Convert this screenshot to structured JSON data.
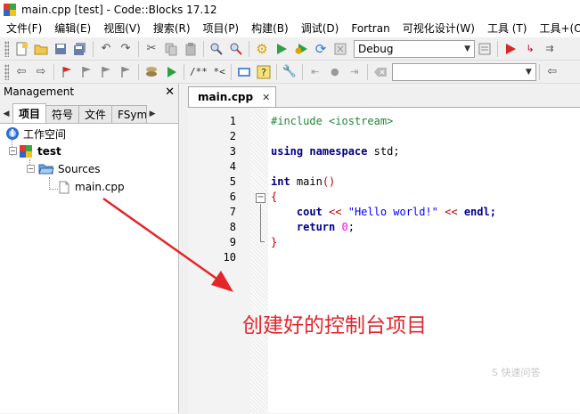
{
  "window": {
    "title": "main.cpp [test] - Code::Blocks 17.12"
  },
  "menu": [
    "文件(F)",
    "编辑(E)",
    "视图(V)",
    "搜索(R)",
    "项目(P)",
    "构建(B)",
    "调试(D)",
    "Fortran",
    "可视化设计(W)",
    "工具 (T)",
    "工具+(O)"
  ],
  "toolbar": {
    "build_target": "Debug",
    "doc_comment": "/** *<",
    "search_value": ""
  },
  "management": {
    "title": "Management",
    "tabs": [
      "项目",
      "符号",
      "文件",
      "FSym"
    ],
    "tree": {
      "workspace": "工作空间",
      "project": "test",
      "folder": "Sources",
      "file": "main.cpp"
    }
  },
  "editor": {
    "tab_label": "main.cpp",
    "line_numbers": [
      "1",
      "2",
      "3",
      "4",
      "5",
      "6",
      "7",
      "8",
      "9",
      "10"
    ],
    "code": {
      "l1_include": "#include <iostream>",
      "l3_using": "using",
      "l3_namespace": "namespace",
      "l3_std": "std;",
      "l5_int": "int",
      "l5_main": "main",
      "l5_parens": "()",
      "l6_open": "{",
      "l7_cout": "cout",
      "l7_op1": "<<",
      "l7_str": "\"Hello world!\"",
      "l7_op2": "<<",
      "l7_endl": "endl;",
      "l8_return": "return",
      "l8_zero": "0",
      "l8_semi": ";",
      "l9_close": "}"
    }
  },
  "annotation": {
    "text": "创建好的控制台项目"
  },
  "watermark": {
    "text": "S 快速问答"
  },
  "colors": {
    "annotation": "#e3262a",
    "keyword": "#00008b",
    "string": "#0000ff",
    "preprocessor": "#22863a"
  }
}
